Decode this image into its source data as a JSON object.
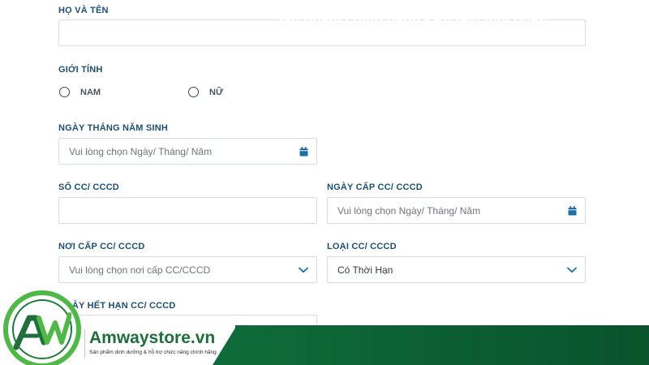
{
  "form": {
    "full_name": {
      "label": "HỌ VÀ TÊN",
      "value": ""
    },
    "gender": {
      "label": "GIỚI TÍNH",
      "options": [
        "NAM",
        "NỮ"
      ]
    },
    "dob": {
      "label": "NGÀY THÁNG NĂM SINH",
      "placeholder": "Vui lòng chọn Ngày/ Tháng/ Năm"
    },
    "id_number": {
      "label": "SỐ CC/ CCCD",
      "value": ""
    },
    "issue_date": {
      "label": "NGÀY CẤP CC/ CCCD",
      "placeholder": "Vui lòng chọn Ngày/ Tháng/ Năm"
    },
    "issue_place": {
      "label": "NƠI CẤP CC/ CCCD",
      "placeholder": "Vui lòng chọn nơi cấp CC/CCCD"
    },
    "id_type": {
      "label": "LOẠI CC/ CCCD",
      "value": "Có Thời Hạn"
    },
    "expiry_date": {
      "label": "NGÀY HẾT HẠN CC/ CCCD"
    }
  },
  "brand": {
    "name": "Amwaystore.vn",
    "tagline": "Sản phẩm dinh dưỡng & hỗ trợ chức năng chính hãng",
    "slogan": "Sản phẩm chính hãng - An tâm mỗi ngày",
    "primary_color": "#0f6b3a",
    "accent_color": "#4fb948",
    "label_color": "#1d4f73",
    "icon_color": "#1d6fa5"
  }
}
